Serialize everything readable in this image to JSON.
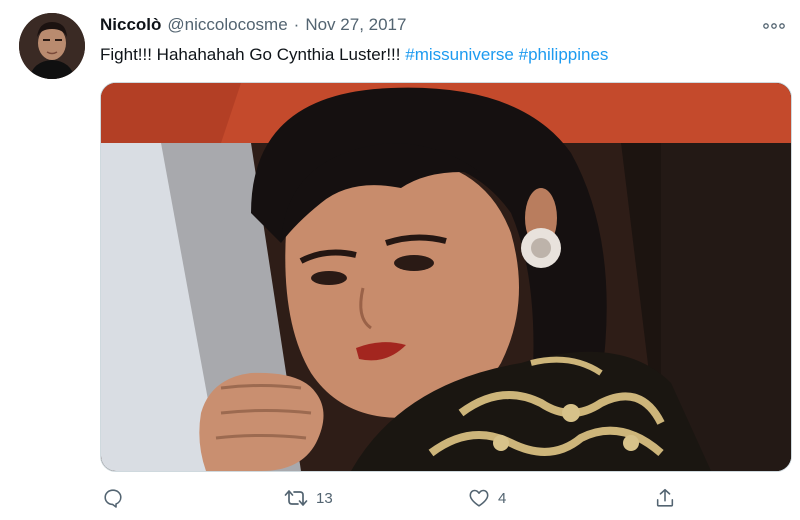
{
  "tweet": {
    "author_name": "Niccolò",
    "handle": "@niccolocosme",
    "separator": "·",
    "date": "Nov 27, 2017",
    "text_plain": "Fight!!! Hahahahah Go Cynthia Luster!!! ",
    "hashtags": [
      "#missuniverse",
      "#philippines"
    ]
  },
  "actions": {
    "reply_count": "",
    "retweet_count": "13",
    "like_count": "4"
  },
  "icons": {
    "more": "more-horizontal-icon",
    "reply": "reply-bubble-icon",
    "retweet": "retweet-arrows-icon",
    "like": "heart-icon",
    "share": "share-upload-icon"
  },
  "colors": {
    "link": "#1d9bf0",
    "text": "#0f1419",
    "muted": "#536471",
    "border": "#cfd9de"
  }
}
